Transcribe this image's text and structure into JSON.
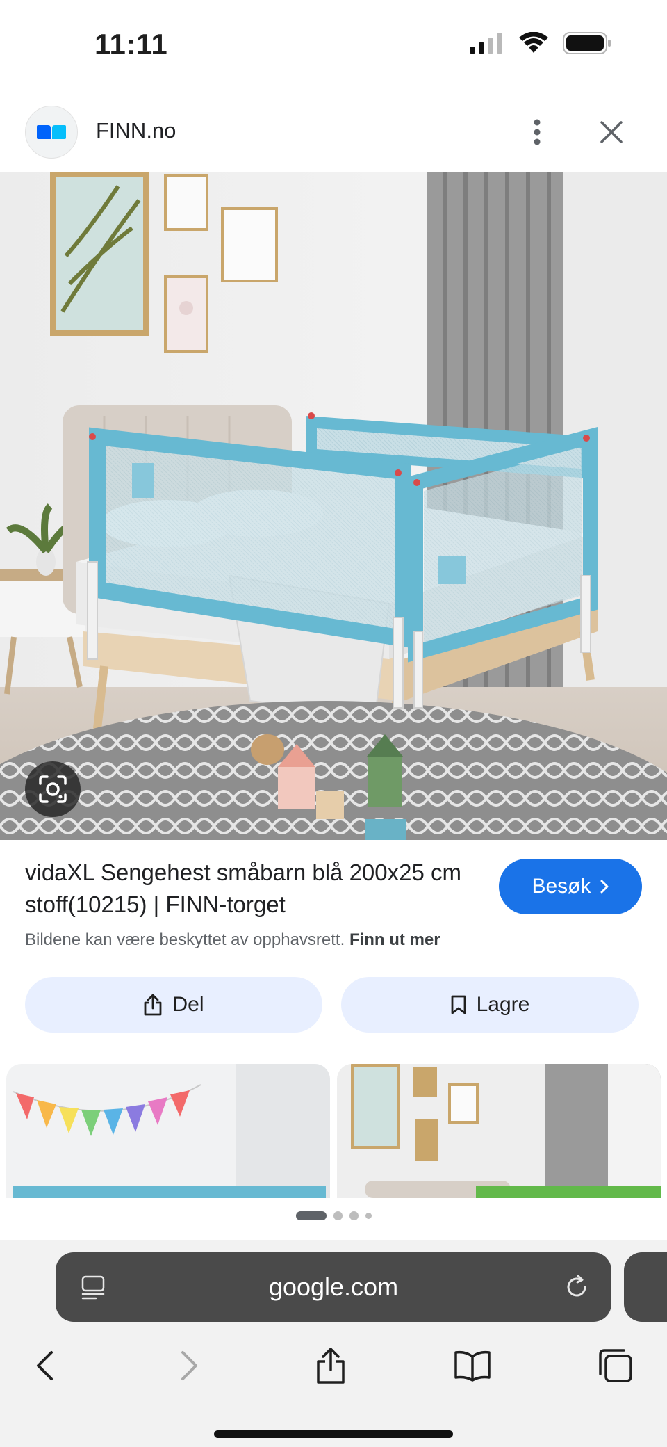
{
  "status_bar": {
    "time": "11:11"
  },
  "header": {
    "site_name": "FINN.no"
  },
  "result": {
    "title": "vidaXL Sengehest småbarn blå 200x25 cm stoff(10215) | FINN-torget",
    "visit_label": "Besøk",
    "copyright_text": "Bildene kan være beskyttet av opphavsrett.",
    "learn_more": "Finn ut mer"
  },
  "actions": {
    "share_label": "Del",
    "save_label": "Lagre"
  },
  "browser": {
    "url": "google.com"
  },
  "icons": {
    "signal": "cellular-signal-icon",
    "wifi": "wifi-icon",
    "battery": "battery-icon",
    "more": "more-vertical-icon",
    "close": "close-icon",
    "lens": "google-lens-icon",
    "share": "share-icon",
    "bookmark": "bookmark-icon",
    "reader": "reader-mode-icon",
    "reload": "reload-icon",
    "back": "back-icon",
    "forward": "forward-icon",
    "bookmarks": "bookmarks-book-icon",
    "tabs": "tabs-icon"
  },
  "colors": {
    "accent": "#1a73e8",
    "tonal_button": "#e8efff",
    "guard_blue": "#67b9d2",
    "guard_green": "#62b94a"
  }
}
